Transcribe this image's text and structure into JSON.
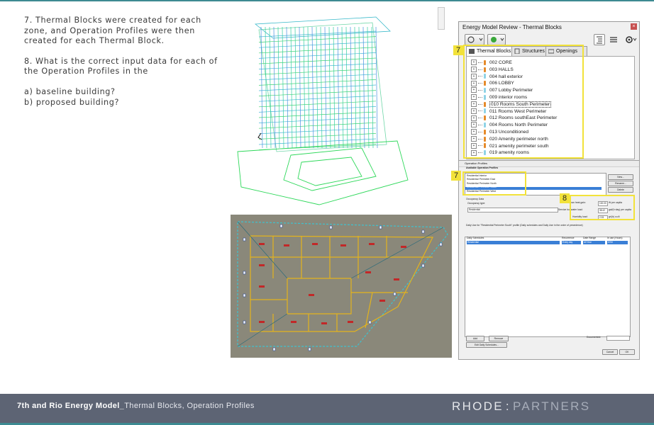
{
  "slide": {
    "item7": "7. Thermal Blocks were created for each zone, and Operation Profiles were then created for each Thermal Block.",
    "item8": "8. What is the correct input data for each of the Operation Profiles in the",
    "qa": "a) baseline building?",
    "qb": "b) proposed building?"
  },
  "window": {
    "title": "Energy Model Review - Thermal Blocks",
    "tabs": [
      "Thermal Blocks",
      "Structures",
      "Openings"
    ],
    "badge": "7",
    "blocks": [
      {
        "label": "002 CORE",
        "color": "#e58a2a"
      },
      {
        "label": "003 HALLS",
        "color": "#e58a2a"
      },
      {
        "label": "004 hall exterior",
        "color": "#8fd3e6"
      },
      {
        "label": "006 LOBBY",
        "color": "#e58a2a"
      },
      {
        "label": "007 Lobby Perimeter",
        "color": "#8fd3e6"
      },
      {
        "label": "009 interior rooms",
        "color": "#8fd3e6"
      },
      {
        "label": "010 Rooms South Perimeter",
        "color": "#e58a2a",
        "selected": true
      },
      {
        "label": "011 Rooms West Perimeter",
        "color": "#8fd3e6"
      },
      {
        "label": "012 Rooms southEast Perimeter",
        "color": "#e58a2a"
      },
      {
        "label": "004 Rooms North Perimeter",
        "color": "#8fd3e6"
      },
      {
        "label": "013 Unconditioned",
        "color": "#e58a2a"
      },
      {
        "label": "020 Amenity perimeter north",
        "color": "#e58a2a"
      },
      {
        "label": "021 amenity perimeter south",
        "color": "#e58a2a"
      },
      {
        "label": "019 amenity rooms",
        "color": "#8fd3e6"
      }
    ]
  },
  "dialog": {
    "title": "Operation Profiles",
    "available_label": "Available Operation Profiles",
    "profiles": [
      "Residential Interior",
      "Residential Perimeter East",
      "Residential Perimeter North",
      "Residential Perimeter South",
      "Residential Perimeter West"
    ],
    "buttons": {
      "new": "New...",
      "rename": "Rename...",
      "delete": "Delete",
      "add": "Add",
      "remove": "Remove",
      "edit": "Edit Daily Schedules...",
      "cancel": "Cancel",
      "ok": "OK"
    },
    "occupancy_label": "Occupancy Data",
    "occupancy_type_label": "Occupancy type:",
    "occupancy_type": "Residential",
    "gains": [
      {
        "label": "Human heat gain:",
        "value": "100.00",
        "unit": "W per capita"
      },
      {
        "label": "Service hot water load:",
        "value": "38.42",
        "unit": "gal/(h·day) per capita"
      },
      {
        "label": "Humidity load:",
        "value": "2.93",
        "unit": "gr/(h) cu.ft"
      }
    ],
    "badge7": "7",
    "badge8": "8",
    "note": "Daily Use for \"Residential Perimeter South\" profile (Daily schedules and Daily Use in the order of precedence)",
    "columns": [
      "Daily Schedules",
      "Recurrence",
      "Date Range",
      "In use (Hours)"
    ],
    "row": [
      "Residential",
      "Every day",
      "All Year",
      "8760"
    ],
    "documented": "Documented:"
  },
  "footer": {
    "title_bold": "7th and Rio Energy Model_",
    "title_rest": "Thermal Blocks, Operation Profiles",
    "logo_left": "RHODE",
    "logo_sep": ":",
    "logo_right": "PARTNERS"
  },
  "colors": {
    "accent": "#3d8a92",
    "footer": "#5d6474",
    "highlight": "#f2e23a"
  }
}
